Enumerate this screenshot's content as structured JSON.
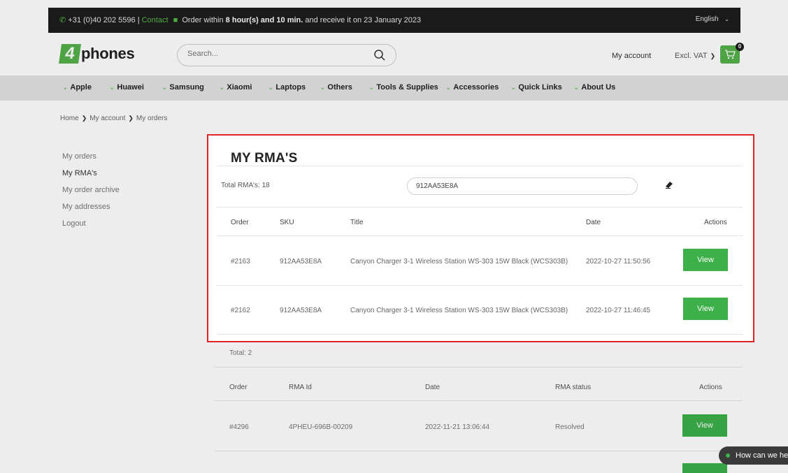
{
  "topbar": {
    "phone": "+31 (0)40 202 5596",
    "separator": "|",
    "contact": "Contact",
    "order_prefix": "Order within",
    "order_bold": "8 hour(s) and 10 min.",
    "order_suffix": "and receive it on 23 January 2023",
    "language": "English"
  },
  "header": {
    "logo_mark": "4",
    "logo_text": "phones",
    "search_placeholder": "Search...",
    "my_account": "My account",
    "vat": "Excl. VAT",
    "cart_count": "0"
  },
  "nav": {
    "items": [
      "Apple",
      "Huawei",
      "Samsung",
      "Xiaomi",
      "Laptops",
      "Others",
      "Tools & Supplies",
      "Accessories",
      "Quick Links",
      "About Us"
    ]
  },
  "breadcrumb": [
    "Home",
    "My account",
    "My orders"
  ],
  "sidebar": {
    "items": [
      "My orders",
      "My RMA's",
      "My order archive",
      "My addresses",
      "Logout"
    ]
  },
  "rma_card": {
    "title": "MY RMA'S",
    "total_label": "Total RMA's: 18",
    "filter_value": "912AA53E8A",
    "columns": [
      "Order",
      "SKU",
      "Title",
      "Date",
      "Actions"
    ],
    "rows": [
      {
        "order": "#2163",
        "sku": "912AA53E8A",
        "title": "Canyon Charger 3-1 Wireless Station WS-303 15W Black (WCS303B)",
        "date": "2022-10-27 11:50:56",
        "action": "View"
      },
      {
        "order": "#2162",
        "sku": "912AA53E8A",
        "title": "Canyon Charger 3-1 Wireless Station WS-303 15W Black (WCS303B)",
        "date": "2022-10-27 11:46:45",
        "action": "View"
      }
    ]
  },
  "lower_table": {
    "total_label": "Total: 2",
    "columns": [
      "Order",
      "RMA Id",
      "Date",
      "RMA status",
      "Actions"
    ],
    "rows": [
      {
        "order": "#4296",
        "rma_id": "4PHEU-696B-00209",
        "date": "2022-11-21 13:06:44",
        "status": "Resolved",
        "action": "View"
      }
    ]
  },
  "chat": {
    "label": "How can we he"
  },
  "colors": {
    "brand_green": "#54b04a",
    "button_green": "#3db04a",
    "highlight_red": "#e02424",
    "topbar_dark": "#1d1d1d"
  }
}
